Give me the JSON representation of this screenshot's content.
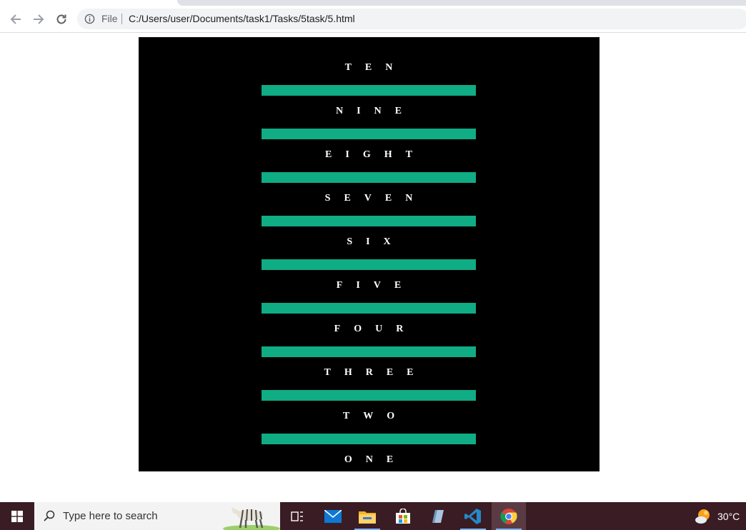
{
  "browser": {
    "file_label": "File",
    "url": "C:/Users/user/Documents/task1/Tasks/5task/5.html"
  },
  "page": {
    "labels": [
      "TEN",
      "NINE",
      "EIGHT",
      "SEVEN",
      "SIX",
      "FIVE",
      "FOUR",
      "THREE",
      "TWO",
      "ONE"
    ],
    "accent_color": "#10ac84",
    "background_color": "#000000"
  },
  "taskbar": {
    "search_placeholder": "Type here to search",
    "temperature": "30°C",
    "apps": [
      "task-view-icon",
      "mail-icon",
      "file-explorer-icon",
      "store-icon",
      "notepad-icon",
      "vscode-icon",
      "chrome-icon"
    ]
  }
}
